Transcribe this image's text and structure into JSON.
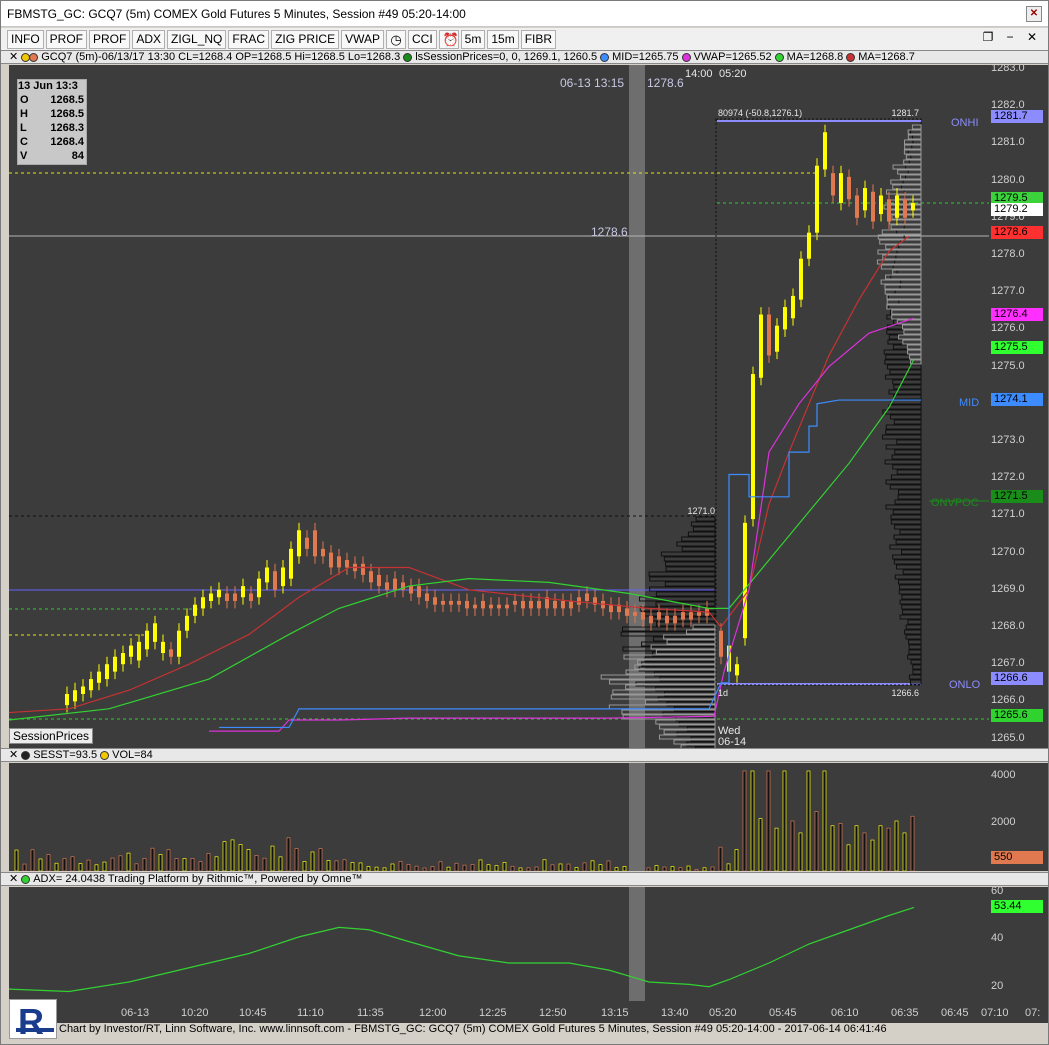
{
  "window": {
    "title": "FBMSTG_GC: GCQ7 (5m) COMEX Gold Futures 5 Minutes, Session #49 05:20-14:00"
  },
  "toolbar": {
    "buttons": [
      "INFO",
      "PROF",
      "PROF",
      "ADX",
      "ZIGL_NQ",
      "FRAC",
      "ZIG PRICE",
      "VWAP",
      "CCI",
      "5m",
      "15m",
      "FIBR"
    ]
  },
  "price_pane": {
    "header": {
      "symbol": "GCQ7 (5m)-06/13/17 13:30 CL=1268.4 OP=1268.5 Hi=1268.5 Lo=1268.3",
      "session": "lsSessionPrices=0, 0, 1269.1, 1260.5",
      "mid": "MID=1265.75",
      "vwap": "VWAP=1265.52",
      "ma1": "MA=1268.8",
      "ma2": "MA=1268.7"
    },
    "ohlc_box": {
      "date": "13 Jun 13:3",
      "O": "1268.5",
      "H": "1268.5",
      "L": "1268.3",
      "C": "1268.4",
      "V": "84"
    },
    "crosshair": {
      "time_label": "06-13 13:15",
      "price_label": "1278.6",
      "left_price": "1278.6"
    },
    "session_open_label": "14:00",
    "session_start_label": "05:20",
    "profile_top_text": "80974 (-50.8,1276.1)",
    "profile_high": "1281.7",
    "profile_low": "1266.6",
    "prev_profile_high": "1271.0",
    "day_label": "1d",
    "date_label": "Wed",
    "date_label2": "06-14",
    "session_prices_button": "SessionPrices",
    "axis_ticks": [
      "1283.0",
      "1282.0",
      "1281.0",
      "1280.0",
      "1279.0",
      "1278.0",
      "1277.0",
      "1276.0",
      "1275.0",
      "1274.0",
      "1273.0",
      "1272.0",
      "1271.0",
      "1270.0",
      "1269.0",
      "1268.0",
      "1267.0",
      "1266.0",
      "1265.0"
    ],
    "tags": [
      {
        "text": "ONHI",
        "value": "1281.7",
        "color": "#8c8cff"
      },
      {
        "text": "",
        "value": "1279.5",
        "color": "#3cd23c"
      },
      {
        "text": "",
        "value": "1279.2",
        "color": "#ffffff"
      },
      {
        "text": "",
        "value": "1278.6",
        "color": "#ff3030"
      },
      {
        "text": "",
        "value": "1276.4",
        "color": "#ff30ff"
      },
      {
        "text": "",
        "value": "1275.5",
        "color": "#30ff30"
      },
      {
        "text": "MID",
        "value": "1274.1",
        "color": "#3c8cff"
      },
      {
        "text": "",
        "value": "1271.5",
        "color": "#1a8c1a"
      },
      {
        "text": "ONLO",
        "value": "1266.6",
        "color": "#8c8cff"
      },
      {
        "text": "",
        "value": "1265.6",
        "color": "#30d230"
      }
    ]
  },
  "volume_pane": {
    "header": {
      "sesst": "SESST=93.5",
      "vol": "VOL=84"
    },
    "axis_ticks": [
      "4000",
      "2000"
    ],
    "tag": "550"
  },
  "adx_pane": {
    "header": "ADX= 24.0438  Trading Platform by Rithmic™, Powered by Omne™",
    "axis_ticks": [
      "60",
      "40",
      "20"
    ],
    "tag": "53.44"
  },
  "time_axis": [
    "06-13",
    "10:20",
    "10:45",
    "11:10",
    "11:35",
    "12:00",
    "12:25",
    "12:50",
    "13:15",
    "13:40",
    "05:20",
    "05:45",
    "06:10",
    "06:35",
    "06:45",
    "07:10",
    "07:"
  ],
  "footer": "Chart by Investor/RT, Linn Software, Inc. www.linnsoft.com - FBMSTG_GC: GCQ7 (5m) COMEX Gold Futures 5 Minutes, Session #49 05:20-14:00 - 2017-06-14 06:41:46",
  "colors": {
    "background": "#3c3c3c",
    "up": "#ffff00",
    "down": "#e07850",
    "ma_red": "#c83232",
    "ma_green": "#32d232",
    "vwap": "#dc32dc",
    "mid": "#3c8cff"
  }
}
